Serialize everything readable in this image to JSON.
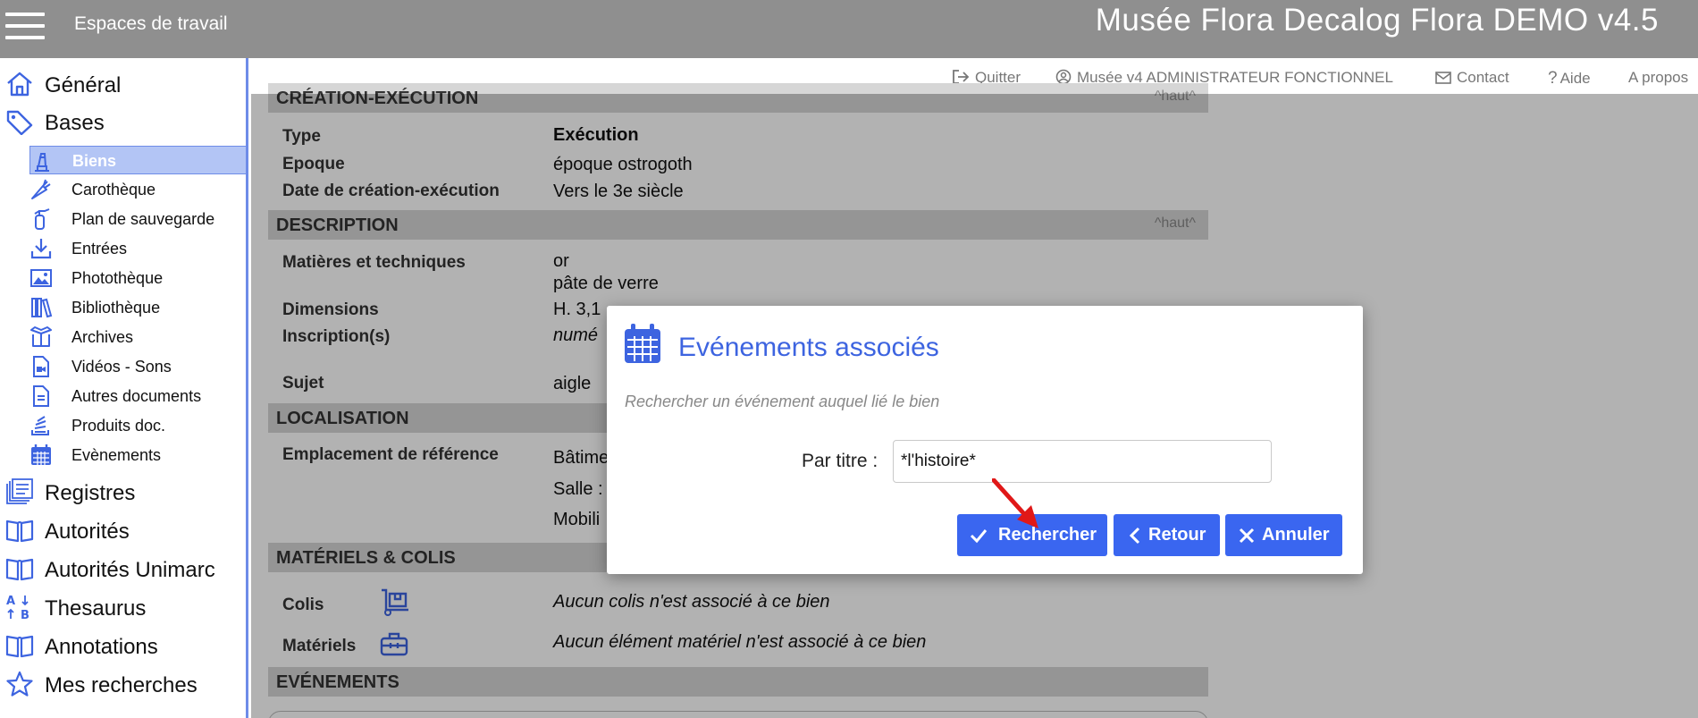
{
  "header": {
    "workspaces_label": "Espaces de travail",
    "app_title": "Musée Flora Decalog Flora DEMO v4.5",
    "bg_color": "#8f8f8f"
  },
  "top_links": {
    "quit": "Quitter",
    "user": "Musée v4 ADMINISTRATEUR FONCTIONNEL",
    "contact": "Contact",
    "help": "Aide",
    "about": "A propos"
  },
  "sidebar": {
    "accent_color": "#3d64e0",
    "general": "Général",
    "bases": "Bases",
    "sub_items": [
      {
        "label": "Biens",
        "icon": "object-icon",
        "active": true
      },
      {
        "label": "Carothèque",
        "icon": "carrot-icon"
      },
      {
        "label": "Plan de sauvegarde",
        "icon": "extinguisher-icon"
      },
      {
        "label": "Entrées",
        "icon": "download-icon"
      },
      {
        "label": "Photothèque",
        "icon": "image-icon"
      },
      {
        "label": "Bibliothèque",
        "icon": "books-icon"
      },
      {
        "label": "Archives",
        "icon": "box-icon"
      },
      {
        "label": "Vidéos - Sons",
        "icon": "video-file-icon"
      },
      {
        "label": "Autres documents",
        "icon": "document-icon"
      },
      {
        "label": "Produits doc.",
        "icon": "stack-icon"
      },
      {
        "label": "Evènements",
        "icon": "calendar-icon"
      }
    ],
    "bottom_items": [
      {
        "label": "Registres",
        "icon": "registers-icon"
      },
      {
        "label": "Autorités",
        "icon": "book-open-icon"
      },
      {
        "label": "Autorités Unimarc",
        "icon": "book-open-icon"
      },
      {
        "label": "Thesaurus",
        "icon": "sort-alpha-icon"
      },
      {
        "label": "Annotations",
        "icon": "book-open-icon"
      },
      {
        "label": "Mes recherches",
        "icon": "star-icon"
      }
    ]
  },
  "record": {
    "up_link": "^haut^",
    "creation": {
      "heading": "CRÉATION-EXÉCUTION",
      "type_label": "Type",
      "type_value": "Exécution",
      "epoque_label": "Epoque",
      "epoque_value": "époque ostrogoth",
      "date_label": "Date de création-exécution",
      "date_value": "Vers le 3e siècle"
    },
    "description": {
      "heading": "DESCRIPTION",
      "matieres_label": "Matières et techniques",
      "matieres_value_1": "or",
      "matieres_value_2": "pâte de verre",
      "dimensions_label": "Dimensions",
      "dimensions_value": "H. 3,1",
      "inscriptions_label": "Inscription(s)",
      "inscriptions_value": "numé",
      "sujet_label": "Sujet",
      "sujet_value": "aigle"
    },
    "localisation": {
      "heading": "LOCALISATION",
      "emplacement_label": "Emplacement de référence",
      "emplacement_value_1": "Bâtime",
      "emplacement_value_2": "Salle :",
      "emplacement_value_3": "Mobili"
    },
    "materiels": {
      "heading": "MATÉRIELS & COLIS",
      "colis_label": "Colis",
      "colis_value": "Aucun colis n'est associé à ce bien",
      "materiels_label": "Matériels",
      "materiels_value": "Aucun élément matériel n'est associé à ce bien"
    },
    "evenements": {
      "heading": "EVÉNEMENTS"
    }
  },
  "dialog": {
    "title": "Evénements associés",
    "hint": "Rechercher un événement auquel lié le bien",
    "title_field_label": "Par titre  :",
    "title_field_value": "*l'histoire*",
    "search_button": "Rechercher",
    "back_button": "Retour",
    "cancel_button": "Annuler",
    "button_color": "#3a66f0",
    "title_color": "#3d64e0"
  }
}
